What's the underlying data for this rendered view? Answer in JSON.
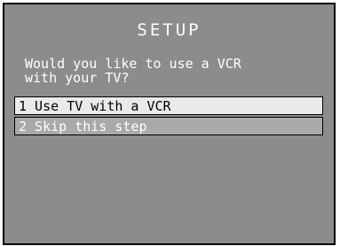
{
  "setup": {
    "title": "SETUP",
    "question": "Would you like to use a VCR\nwith your TV?",
    "options": [
      {
        "label": "1 Use TV with a VCR",
        "selected": true
      },
      {
        "label": "2 Skip this step",
        "selected": false
      }
    ]
  },
  "colors": {
    "background": "#8c8c8c",
    "highlight": "#eaeaea",
    "option_background": "#a9a9a9",
    "text": "#ffffff",
    "selected_text": "#000000"
  }
}
